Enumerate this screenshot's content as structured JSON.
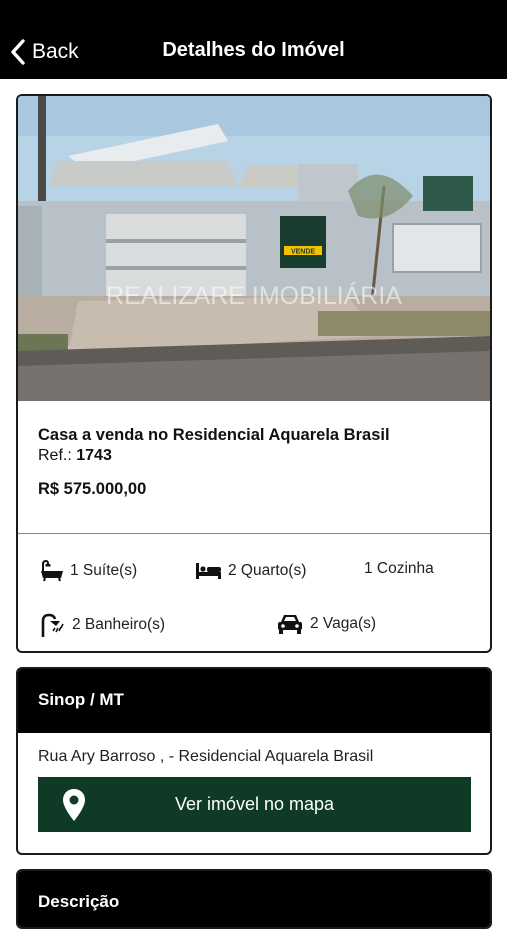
{
  "nav": {
    "back_label": "Back",
    "title": "Detalhes do Imóvel"
  },
  "property": {
    "title": "Casa a venda no Residencial Aquarela Brasil",
    "ref_label": "Ref.:",
    "ref_value": "1743",
    "price": "R$ 575.000,00",
    "photo_watermark": "REALIZARE IMOBILIÁRIA",
    "photo_sign": "VENDE",
    "features": {
      "suites": "1 Suíte(s)",
      "bedrooms": "2 Quarto(s)",
      "kitchen": "1 Cozinha",
      "bathrooms": "2 Banheiro(s)",
      "garage": "2 Vaga(s)"
    }
  },
  "location": {
    "header": "Sinop / MT",
    "address": "Rua Ary Barroso , - Residencial Aquarela Brasil",
    "map_button_label": "Ver imóvel no mapa"
  },
  "description": {
    "header": "Descrição"
  },
  "colors": {
    "nav_bg": "#000000",
    "map_button": "#0e3a26",
    "card_border": "#1a1a1a"
  }
}
